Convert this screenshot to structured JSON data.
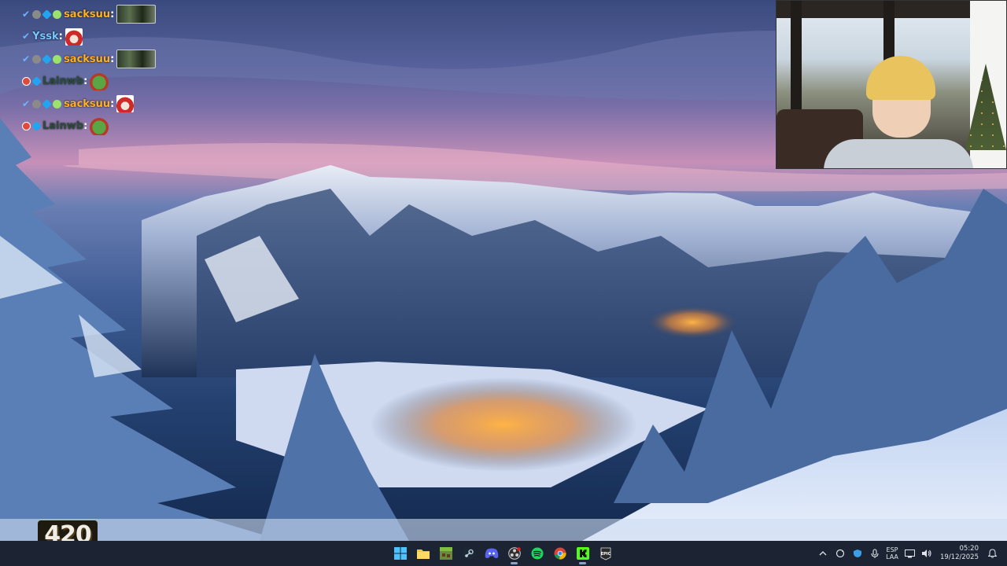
{
  "chat": {
    "messages": [
      {
        "badges": [
          "checkmark-badge-icon",
          "grey-badge-icon",
          "blue-gem-badge-icon",
          "green-badge-icon"
        ],
        "user": "sacksuu",
        "user_color": "#ffb121",
        "emote": "webcam-emote"
      },
      {
        "badges": [
          "checkmark-badge-icon"
        ],
        "user": "Yssk",
        "user_color": "#79c8ff",
        "emote": "santa-emote"
      },
      {
        "badges": [
          "checkmark-badge-icon",
          "grey-badge-icon",
          "blue-gem-badge-icon",
          "green-badge-icon"
        ],
        "user": "sacksuu",
        "user_color": "#ffb121",
        "emote": "webcam-emote"
      },
      {
        "badges": [
          "red-badge-icon",
          "blue-gem-badge-icon"
        ],
        "user": "Lainwb",
        "user_color": "#2d4d3c",
        "emote": "frog-emote"
      },
      {
        "badges": [
          "checkmark-badge-icon",
          "grey-badge-icon",
          "blue-gem-badge-icon",
          "green-badge-icon"
        ],
        "user": "sacksuu",
        "user_color": "#ffb121",
        "emote": "santa-emote"
      },
      {
        "badges": [
          "red-badge-icon",
          "blue-gem-badge-icon"
        ],
        "user": "Lainwb",
        "user_color": "#2d4d3c",
        "emote": "frog-emote"
      }
    ],
    "colon": ":"
  },
  "logo": {
    "text": "420"
  },
  "taskbar": {
    "apps": [
      "windows-start-icon",
      "file-explorer-icon",
      "minecraft-icon",
      "steam-icon",
      "discord-icon",
      "obs-icon",
      "spotify-icon",
      "chrome-icon",
      "kick-icon",
      "epic-games-icon"
    ],
    "tray": {
      "language_line1": "ESP",
      "language_line2": "LAA",
      "time": "05:20",
      "date": "19/12/2025"
    }
  },
  "colors": {
    "taskbar_bg": "#1c2434",
    "username_orange": "#ffb121",
    "username_cyan": "#79c8ff"
  }
}
